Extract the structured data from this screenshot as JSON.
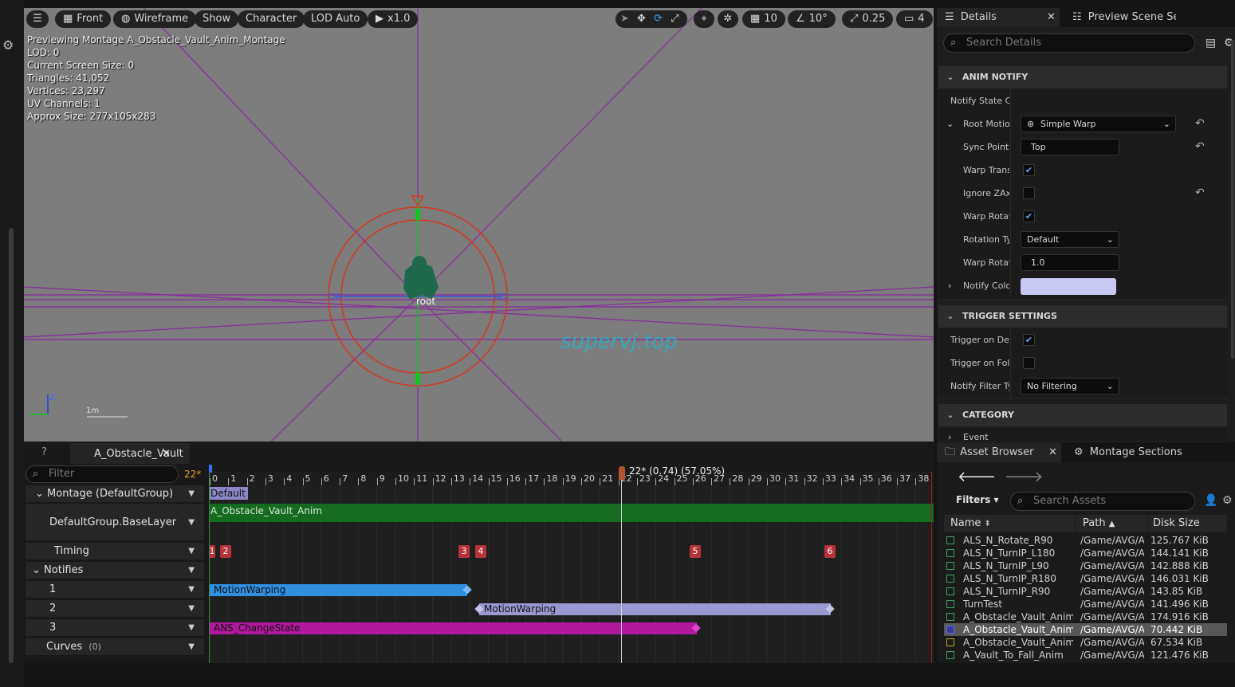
{
  "viewport": {
    "toolbar": {
      "menu_icon": "hamburger-icon",
      "view_mode": "Front",
      "lighting": "Wireframe",
      "show": "Show",
      "character": "Character",
      "lod": "LOD Auto",
      "play_speed": "x1.0",
      "grid_size": "10",
      "rotation_snap": "10°",
      "scale_snap": "0.25",
      "camera_speed": "4"
    },
    "stats": [
      "Previewing Montage A_Obstacle_Vault_Anim_Montage",
      "LOD: 0",
      "Current Screen Size: 0",
      "Triangles: 41,052",
      "Vertices: 23,297",
      "UV Channels: 1",
      "Approx Size: 277x105x283"
    ],
    "bone_label": "root",
    "watermark": "supervj.top",
    "scale_label": "1m",
    "axis_label": "Z"
  },
  "details": {
    "tabs": [
      "Details",
      "Preview Scene Se"
    ],
    "search_placeholder": "Search Details",
    "anim_notify_header": "ANIM NOTIFY",
    "rows": {
      "notify_state_class": "Notify State Cl",
      "root_motion": "Root Motior",
      "root_motion_value": "Simple Warp",
      "sync_point": "Sync Point I",
      "sync_point_value": "Top",
      "warp_translation": "Warp Transl",
      "ignore_z": "Ignore ZAxis",
      "warp_rotation": "Warp Rotatio",
      "rotation_type": "Rotation Typ",
      "rotation_type_value": "Default",
      "warp_rotation_time": "Warp Rotatio",
      "warp_rotation_time_value": "1.0",
      "notify_color": "Notify Color"
    },
    "trigger_header": "TRIGGER SETTINGS",
    "trigger_rows": {
      "trigger_dedicated": "Trigger on Dedi",
      "trigger_follower": "Trigger on Follo",
      "filter_type": "Notify Filter Ty",
      "filter_type_value": "No Filtering"
    },
    "category_header": "CATEGORY",
    "event_row": "Event",
    "notify_color_hex": "#c8c8f4"
  },
  "timeline": {
    "tab_label": "A_Obstacle_Vault",
    "filter_placeholder": "Filter",
    "frame_badge": "22*",
    "scrub_label": "22* (0.74) (57.05%)",
    "ruler": [
      "0",
      "1",
      "2",
      "3",
      "4",
      "5",
      "6",
      "7",
      "8",
      "9",
      "10",
      "11",
      "12",
      "13",
      "14",
      "15",
      "16",
      "17",
      "18",
      "19",
      "20",
      "21",
      "22",
      "23",
      "24",
      "25",
      "26",
      "27",
      "28",
      "29",
      "30",
      "31",
      "32",
      "33",
      "34",
      "35",
      "36",
      "37",
      "38"
    ],
    "rows": {
      "montage": "Montage (DefaultGroup)",
      "slot": "DefaultGroup.BaseLayer",
      "timing": "Timing",
      "notifies": "Notifies",
      "track1": "1",
      "track2": "2",
      "track3": "3",
      "curves": "Curves",
      "curves_count": "(0)"
    },
    "section_label": "Default",
    "anim_segment": "A_Obstacle_Vault_Anim",
    "timing_markers": [
      "1",
      "2",
      "3",
      "4",
      "5",
      "6"
    ],
    "notifies_list": {
      "n1": "MotionWarping",
      "n2": "MotionWarping",
      "n3": "ANS_ChangeState"
    }
  },
  "asset_browser": {
    "tabs": [
      "Asset Browser",
      "Montage Sections"
    ],
    "filters_label": "Filters",
    "search_placeholder": "Search Assets",
    "columns": {
      "name": "Name",
      "path": "Path",
      "size": "Disk Size"
    },
    "items": [
      {
        "name": "ALS_N_Rotate_R90",
        "path": "/Game/AVG/A",
        "size": "125.767 KiB"
      },
      {
        "name": "ALS_N_TurnIP_L180",
        "path": "/Game/AVG/A",
        "size": "144.141 KiB"
      },
      {
        "name": "ALS_N_TurnIP_L90",
        "path": "/Game/AVG/A",
        "size": "142.888 KiB"
      },
      {
        "name": "ALS_N_TurnIP_R180",
        "path": "/Game/AVG/A",
        "size": "146.031 KiB"
      },
      {
        "name": "ALS_N_TurnIP_R90",
        "path": "/Game/AVG/A",
        "size": "143.85 KiB"
      },
      {
        "name": "TurnTest",
        "path": "/Game/AVG/A",
        "size": "141.496 KiB"
      },
      {
        "name": "A_Obstacle_Vault_Anim",
        "path": "/Game/AVG/A",
        "size": "174.916 KiB"
      },
      {
        "name": "A_Obstacle_Vault_Anim_",
        "path": "/Game/AVG/A",
        "size": "70.442 KiB"
      },
      {
        "name": "A_Obstacle_Vault_Anim_",
        "path": "/Game/AVG/A",
        "size": "67.534 KiB"
      },
      {
        "name": "A_Vault_To_Fall_Anim",
        "path": "/Game/AVG/A",
        "size": "121.476 KiB"
      }
    ],
    "selected_index": 7
  },
  "colors": {
    "viewport_bg": "#7d7d7d",
    "wire_purple": "#8a2aa0",
    "ring_red": "#d6381c",
    "anim_green": "#156b1e",
    "notify_blue": "#2f8fe0",
    "notify_lavender": "#9a98d0",
    "notify_magenta": "#b0199c",
    "timing_red": "#b8323a"
  }
}
